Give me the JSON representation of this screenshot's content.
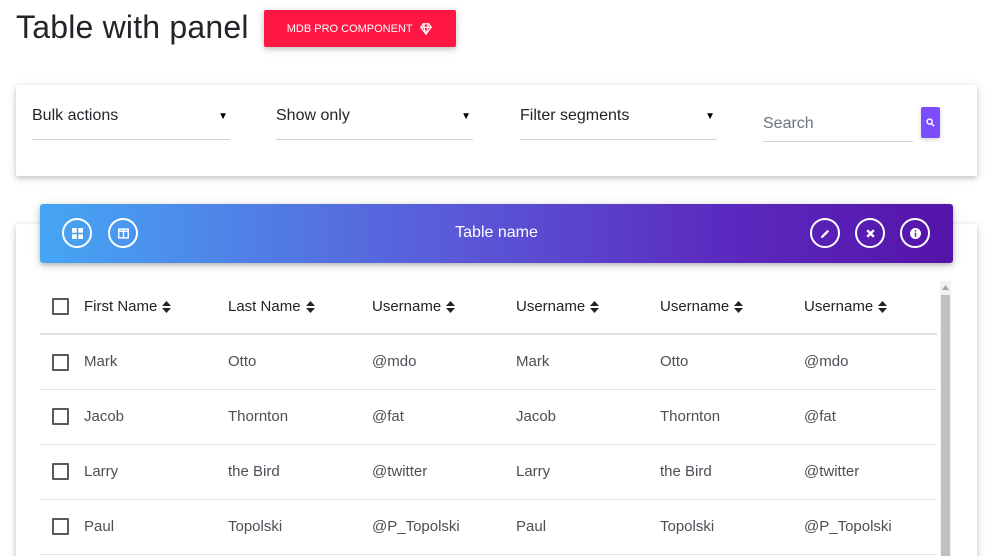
{
  "header": {
    "title": "Table with panel",
    "pro_button_label": "MDB PRO COMPONENT",
    "pro_button_icon": "gem-icon",
    "accent_color": "#ff1744"
  },
  "filters": {
    "bulk_actions": "Bulk actions",
    "show_only": "Show only",
    "filter_segments": "Filter segments",
    "search_placeholder": "Search",
    "search_button_icon": "search-icon",
    "search_button_color": "#7c4dff"
  },
  "panel": {
    "title": "Table name",
    "left_icons": [
      "grid-icon",
      "columns-icon"
    ],
    "right_icons": [
      "pencil-icon",
      "close-icon",
      "info-icon"
    ],
    "gradient_colors": [
      "#45a6f4",
      "#5513a8"
    ]
  },
  "table": {
    "columns": [
      "First Name",
      "Last Name",
      "Username",
      "Username",
      "Username",
      "Username"
    ],
    "rows": [
      [
        "Mark",
        "Otto",
        "@mdo",
        "Mark",
        "Otto",
        "@mdo"
      ],
      [
        "Jacob",
        "Thornton",
        "@fat",
        "Jacob",
        "Thornton",
        "@fat"
      ],
      [
        "Larry",
        "the Bird",
        "@twitter",
        "Larry",
        "the Bird",
        "@twitter"
      ],
      [
        "Paul",
        "Topolski",
        "@P_Topolski",
        "Paul",
        "Topolski",
        "@P_Topolski"
      ]
    ]
  }
}
